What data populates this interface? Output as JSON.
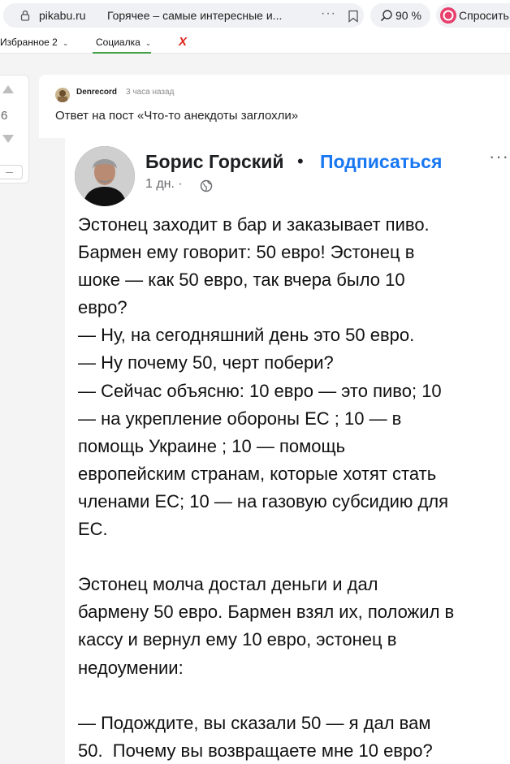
{
  "browser": {
    "domain": "pikabu.ru",
    "tab_title": "Горячее – самые интересные и...",
    "menu_dots": "···",
    "zoom": "90 %",
    "ask_button": "Спросить"
  },
  "bookmarks": {
    "favorites": "Избранное 2",
    "social": "Социалка",
    "close_mark": "X"
  },
  "rating": {
    "score": "6"
  },
  "comment": {
    "author": "Denrecord",
    "time": "3 часа назад",
    "reply_to": "Ответ на пост «Что-то анекдоты заглохли»"
  },
  "embedded_post": {
    "author": "Борис Горский",
    "separator": "•",
    "follow": "Подписаться",
    "more": "···",
    "meta": "1 дн. ·",
    "text": "Эстонец заходит в бар и заказывает пиво.\nБармен ему говорит: 50 евро! Эстонец в\nшоке — как 50 евро, так вчера было 10\nевро?\n— Ну, на сегодняшний день это 50 евро.\n— Ну почему 50, черт побери?\n— Сейчас объясню: 10 евро — это пиво; 10\n— на укрепление обороны ЕС ; 10 — в\nпомощь Украине ; 10 — помощь\nевропейским странам, которые хотят стать\nчленами ЕС; 10 — на газовую субсидию для\nЕС.\n\nЭстонец молча достал деньги и дал\nбармену 50 евро. Бармен взял их, положил в\nкассу и вернул ему 10 евро, эстонец в\nнедоумении:\n\n— Подождите, вы сказали 50 — я дал вам\n50.  Почему вы возвращаете мне 10 евро?\n— ПИВА НЕТ !!!"
  },
  "colors": {
    "accent_follow": "#1877f2",
    "bookmark_underline": "#43a047",
    "close_mark": "#e0261b",
    "ask_icon": "#e83e6b"
  },
  "icons": [
    "lock-icon",
    "bookmark-icon",
    "zoom-icon",
    "ask-icon",
    "chevron-down-icon",
    "upvote-icon",
    "downvote-icon",
    "globe-icon"
  ]
}
